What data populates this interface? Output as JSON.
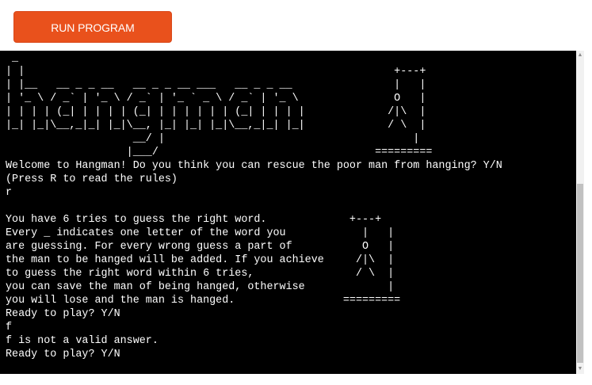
{
  "toolbar": {
    "run_label": "RUN PROGRAM"
  },
  "terminal": {
    "output": " _\n| |                                                          +---+\n| |__   __ _ _ __   __ _ _ __ ___   __ _ _ __                |   |\n| '_ \\ / _` | '_ \\ / _` | '_ ` _ \\ / _` | '_ \\               O   |\n| | | | (_| | | | | (_| | | | | | | (_| | | | |             /|\\  |\n|_| |_|\\__,_|_| |_|\\__, |_| |_| |_|\\__,_|_| |_|             / \\  |\n                    __/ |                                       |\n                   |___/                                  =========\nWelcome to Hangman! Do you think you can rescue the poor man from hanging? Y/N\n(Press R to read the rules)\nr\n\nYou have 6 tries to guess the right word.             +---+\nEvery _ indicates one letter of the word you            |   |\nare guessing. For every wrong guess a part of           O   |\nthe man to be hanged will be added. If you achieve     /|\\  |\nto guess the right word within 6 tries,                / \\  |\nyou can save the man of being hanged, otherwise             |\nyou will lose and the man is hanged.                 =========\nReady to play? Y/N\nf\nf is not a valid answer.\nReady to play? Y/N"
  },
  "scrollbar": {
    "up_glyph": "▲",
    "down_glyph": "▼"
  },
  "colors": {
    "button": "#e9511c",
    "terminal_bg": "#000000",
    "terminal_text": "#ffffff"
  }
}
